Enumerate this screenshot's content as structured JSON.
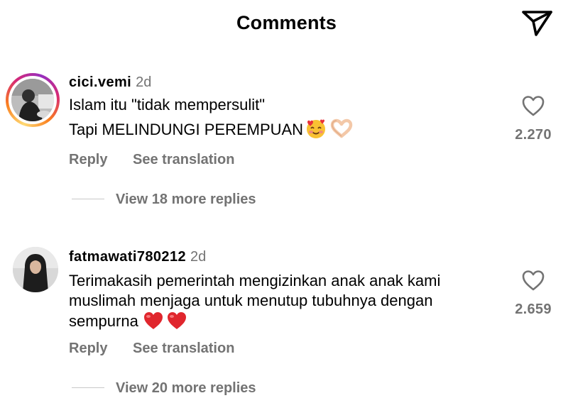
{
  "header": {
    "title": "Comments",
    "send_icon": "send-icon"
  },
  "comments": [
    {
      "username": "cici.vemi",
      "time": "2d",
      "has_story_ring": true,
      "lines": [
        "Islam itu \"tidak mempersulit\"",
        "Tapi MELINDUNGI PEREMPUAN"
      ],
      "emojis": [
        "smiling-face-with-hearts",
        "heart-hands"
      ],
      "reply_label": "Reply",
      "translation_label": "See translation",
      "replies_label": "View 18 more replies",
      "likes": "2.270"
    },
    {
      "username": "fatmawati780212",
      "time": "2d",
      "has_story_ring": false,
      "lines": [
        "Terimakasih pemerintah mengizinkan anak anak kami",
        "muslimah menjaga untuk menutup tubuhnya dengan",
        "sempurna"
      ],
      "emojis": [
        "red-heart",
        "red-heart"
      ],
      "reply_label": "Reply",
      "translation_label": "See translation",
      "replies_label": "View 20 more replies",
      "likes": "2.659"
    }
  ]
}
